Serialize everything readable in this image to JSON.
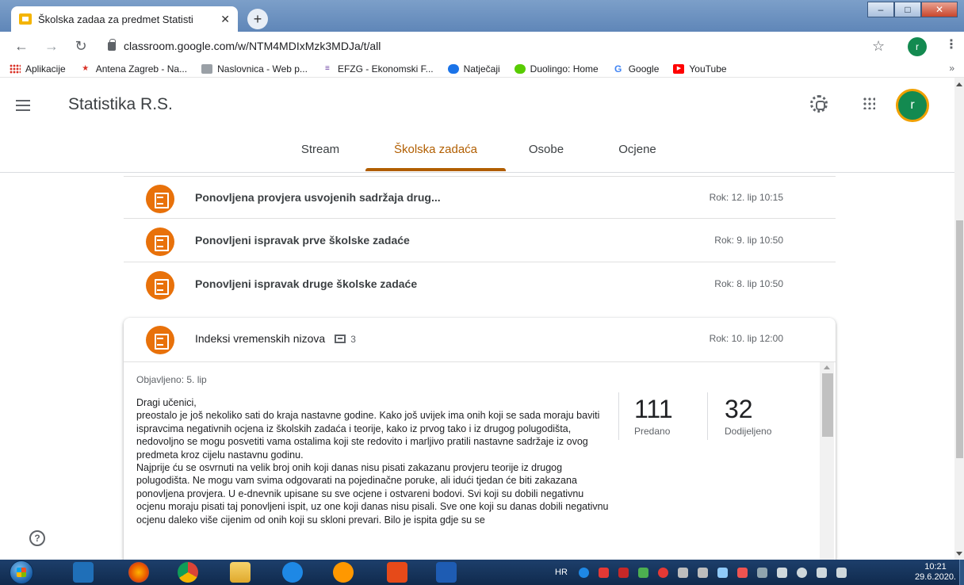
{
  "browser": {
    "tab_title": "Školska zadaa za predmet Statisti",
    "tab_close": "✕",
    "new_tab": "+",
    "url": "classroom.google.com/w/NTM4MDIxMzk3MDJa/t/all",
    "profile_initial": "r",
    "bookmarks": [
      {
        "label": "Aplikacije",
        "icon": "apps-grid-icon",
        "color": "#d93025"
      },
      {
        "label": "Antena Zagreb - Na...",
        "icon": "star-icon",
        "color": "#d93025"
      },
      {
        "label": "Naslovnica - Web p...",
        "icon": "web-icon",
        "color": "#5f6368"
      },
      {
        "label": "EFZG - Ekonomski F...",
        "icon": "efzg-icon",
        "color": "#6a3fa0"
      },
      {
        "label": "Natječaji",
        "icon": "globe-icon",
        "color": "#1a73e8"
      },
      {
        "label": "Duolingo: Home",
        "icon": "duolingo-icon",
        "color": "#58cc02"
      },
      {
        "label": "Google",
        "icon": "google-icon",
        "color": "#4285f4"
      },
      {
        "label": "YouTube",
        "icon": "youtube-icon",
        "color": "#ff0000"
      }
    ],
    "bookmarks_more": "»"
  },
  "classroom": {
    "class_name": "Statistika R.S.",
    "avatar_initial": "r",
    "tabs": [
      "Stream",
      "Školska zadaća",
      "Osobe",
      "Ocjene"
    ],
    "active_tab": "Školska zadaća",
    "accent_color": "#b15e00",
    "assignments": [
      {
        "title": "Ponovljena provjera usvojenih sadržaja drug...",
        "due": "Rok: 12. lip 10:15"
      },
      {
        "title": "Ponovljeni ispravak prve školske zadaće",
        "due": "Rok: 9. lip 10:50"
      },
      {
        "title": "Ponovljeni ispravak druge školske zadaće",
        "due": "Rok: 8. lip 10:50"
      }
    ],
    "expanded": {
      "title": "Indeksi vremenskih nizova",
      "comments": "3",
      "due": "Rok: 10. lip 12:00",
      "posted": "Objavljeno: 5. lip",
      "body": [
        "Dragi učenici,",
        "preostalo je još nekoliko sati do kraja nastavne godine. Kako još uvijek ima onih  koji se sada moraju baviti ispravcima negativnih ocjena iz školskih zadaća i teorije, kako iz prvog tako i iz drugog polugodišta, nedovoljno se mogu posvetiti vama ostalima koji ste redovito i marljivo pratili nastavne sadržaje iz ovog predmeta kroz cijelu nastavnu godinu.",
        "Najprije ću se osvrnuti na velik broj onih koji danas nisu pisati zakazanu provjeru teorije iz drugog polugodišta. Ne mogu vam svima odgovarati na pojedinačne poruke, ali idući tjedan će biti zakazana ponovljena provjera. U e-dnevnik upisane su sve ocjene i ostvareni bodovi. Svi koji su dobili negativnu ocjenu moraju pisati taj ponovljeni ispit, uz one koji danas nisu pisali. Sve one koji su danas dobili negativnu ocjenu daleko više cijenim od onih koji su skloni prevari. Bilo je  ispita gdje su se"
      ],
      "stats": [
        {
          "value": "111",
          "label": "Predano"
        },
        {
          "value": "32",
          "label": "Dodijeljeno"
        }
      ]
    }
  },
  "taskbar": {
    "language": "HR",
    "time": "10:21",
    "date": "29.6.2020."
  }
}
